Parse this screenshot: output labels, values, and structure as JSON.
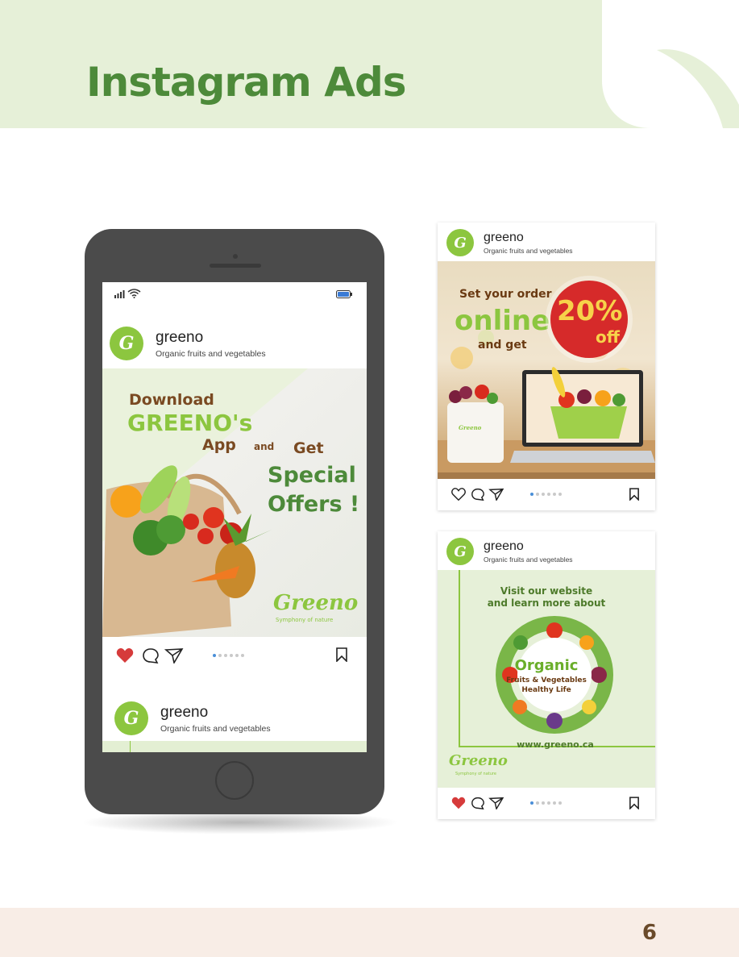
{
  "header": {
    "title": "Instagram Ads"
  },
  "footer": {
    "page_number": "6"
  },
  "brand": {
    "green": "#8cc63f",
    "dark_green": "#4d8a3a",
    "brown": "#6a4a2a",
    "heart_red": "#d63b3b"
  },
  "account": {
    "name": "greeno",
    "subtitle": "Organic fruits and vegetables",
    "logo_letter": "G"
  },
  "phone_ad": {
    "download": "Download",
    "brand_app": "GREENO's",
    "app": "App",
    "and": "and",
    "get": "Get",
    "special": "Special",
    "offers": "Offers !",
    "logo_text": "Greeno",
    "tagline": "Symphony of nature"
  },
  "card1_ad": {
    "line1": "Set your order",
    "line2": "online",
    "line3": "and get",
    "discount": "20%",
    "off": "off",
    "bag_label": "Greeno"
  },
  "card2_ad": {
    "line1": "Visit our website",
    "line2": "and learn more about",
    "organic": "Organic",
    "sub1": "Fruits & Vegetables",
    "sub2": "Healthy Life",
    "url": "www.greeno.ca",
    "logo_text": "Greeno",
    "tagline": "Symphony of nature"
  },
  "icons": [
    "heart-icon",
    "comment-icon",
    "share-icon",
    "bookmark-icon",
    "signal-icon",
    "wifi-icon",
    "battery-icon"
  ]
}
